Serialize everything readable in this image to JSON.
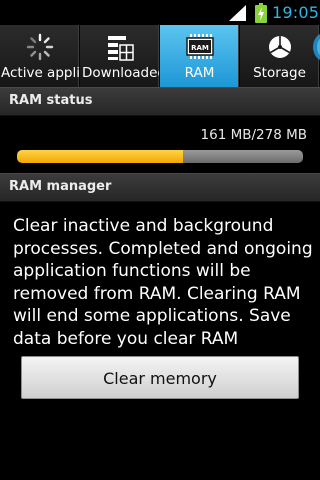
{
  "status_bar": {
    "time": "19:05",
    "icons": [
      "signal-icon",
      "battery-charging-icon"
    ],
    "clock_color": "#33b5e5"
  },
  "tabs": [
    {
      "label": "Active appli",
      "icon": "spinner-icon",
      "active": false
    },
    {
      "label": "Downloaded",
      "icon": "apps-grid-icon",
      "active": false
    },
    {
      "label": "RAM",
      "icon": "ram-chip-icon",
      "active": true
    },
    {
      "label": "Storage",
      "icon": "pie-chart-icon",
      "active": false
    },
    {
      "label": "",
      "icon": "partial-tab-icon",
      "active": false
    }
  ],
  "ram_status": {
    "header": "RAM status",
    "usage_text": "161 MB/278 MB",
    "used_mb": 161,
    "total_mb": 278,
    "used_fraction": 0.579,
    "bar_color": "#ffc20e"
  },
  "ram_manager": {
    "header": "RAM manager",
    "description": "Clear inactive and background processes. Completed and ongoing application functions will be removed from RAM. Clearing RAM will end some applications. Save data before you clear RAM",
    "button_label": "Clear memory"
  },
  "colors": {
    "accent": "#33b5e5",
    "active_tab": "#1e97d6"
  }
}
